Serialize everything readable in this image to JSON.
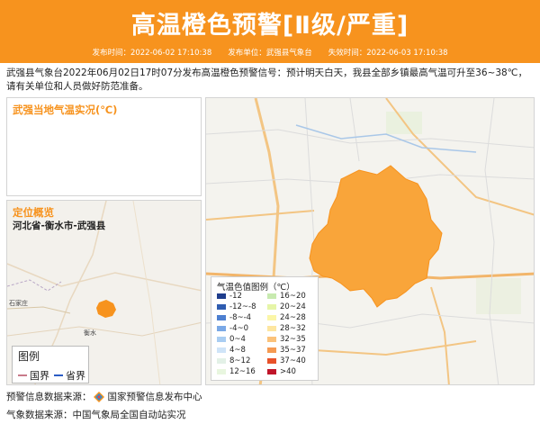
{
  "header": {
    "title": "高温橙色预警[Ⅱ级/严重]",
    "publish_time": "发布时间：2022-06-02 17:10:38",
    "publisher": "发布单位：武强县气象台",
    "expire_time": "失效时间：2022-06-03 17:10:38",
    "color": "#f7931e"
  },
  "description": "武强县气象台2022年06月02日17时07分发布高温橙色预警信号：预计明天白天，我县全部乡镇最高气温可升至36~38℃，请有关单位和人员做好防范准备。",
  "temp_panel": {
    "title": "武强当地气温实况(℃)"
  },
  "location_panel": {
    "title": "定位概览",
    "region": "河北省-衡水市-武强县",
    "map_labels": [
      "石家庄",
      "衡水"
    ],
    "legend_title": "图例",
    "legend_items": [
      {
        "label": "国界",
        "color": "#c97a8a"
      },
      {
        "label": "省界",
        "color": "#2b5cc4"
      }
    ]
  },
  "main_map": {
    "highlight_color": "#f9a53a",
    "legend_title": "气温色值图例（℃）",
    "legend_left": [
      {
        "label": "-12",
        "color": "#1f3d8c"
      },
      {
        "label": "-12~-8",
        "color": "#2f5cb0"
      },
      {
        "label": "-8~-4",
        "color": "#4d7fd0"
      },
      {
        "label": "-4~0",
        "color": "#7aa8e6"
      },
      {
        "label": "0~4",
        "color": "#a9cdf2"
      },
      {
        "label": "4~8",
        "color": "#cfe4f8"
      },
      {
        "label": "8~12",
        "color": "#e3f1e7"
      },
      {
        "label": "12~16",
        "color": "#e8f6df"
      }
    ],
    "legend_right": [
      {
        "label": "16~20",
        "color": "#c8eab0"
      },
      {
        "label": "20~24",
        "color": "#e6f5a8"
      },
      {
        "label": "24~28",
        "color": "#fbf6a8"
      },
      {
        "label": "28~32",
        "color": "#fde6a0"
      },
      {
        "label": "32~35",
        "color": "#fbc27a"
      },
      {
        "label": "35~37",
        "color": "#f59a52"
      },
      {
        "label": "37~40",
        "color": "#e8522a"
      },
      {
        "label": ">40",
        "color": "#c0152a"
      }
    ]
  },
  "footer": {
    "warning_source": "预警信息数据来源：",
    "warning_source_name": "国家预警信息发布中心",
    "weather_source": "气象数据来源：中国气象局全国自动站实况"
  }
}
